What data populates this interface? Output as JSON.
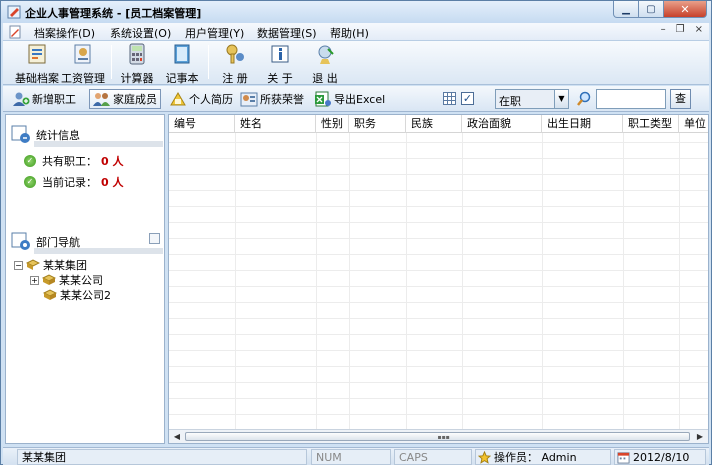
{
  "window": {
    "title": "企业人事管理系统 - [员工档案管理]",
    "controls": {
      "minimize": "▁",
      "maximize": "▢",
      "close": "✕"
    }
  },
  "menu": {
    "items": [
      "档案操作(D)",
      "系统设置(O)",
      "用户管理(Y)",
      "数据管理(S)",
      "帮助(H)"
    ],
    "mdi": {
      "minimize": "–",
      "restore": "❐",
      "close": "×"
    }
  },
  "toolbar1": {
    "buttons": [
      "基础档案",
      "工资管理",
      "计算器",
      "记事本",
      "注 册",
      "关 于",
      "退 出"
    ]
  },
  "toolbar2": {
    "buttons": [
      "新增职工",
      "家庭成员",
      "个人简历",
      "所获荣誉",
      "导出Excel"
    ],
    "checkbox_mark": "✓",
    "status_select": "在职",
    "search_button": "查",
    "search_value": ""
  },
  "left": {
    "stats_title": "统计信息",
    "stats": [
      {
        "label": "共有职工：",
        "value": "0 人"
      },
      {
        "label": "当前记录：",
        "value": "0 人"
      }
    ],
    "dept_title": "部门导航",
    "tree": {
      "root": "某某集团",
      "children": [
        "某某公司",
        "某某公司2"
      ]
    }
  },
  "grid": {
    "columns": [
      "编号",
      "姓名",
      "性别",
      "职务",
      "民族",
      "政治面貌",
      "出生日期",
      "职工类型",
      "单位"
    ]
  },
  "statusbar": {
    "dept": "某某集团",
    "num": "NUM",
    "caps": "CAPS",
    "operator": "操作员： Admin",
    "date": "2012/8/10"
  },
  "colors": {
    "accent": "#cfe1f3",
    "stat_value": "#c00000",
    "close_button": "#c7402a"
  }
}
